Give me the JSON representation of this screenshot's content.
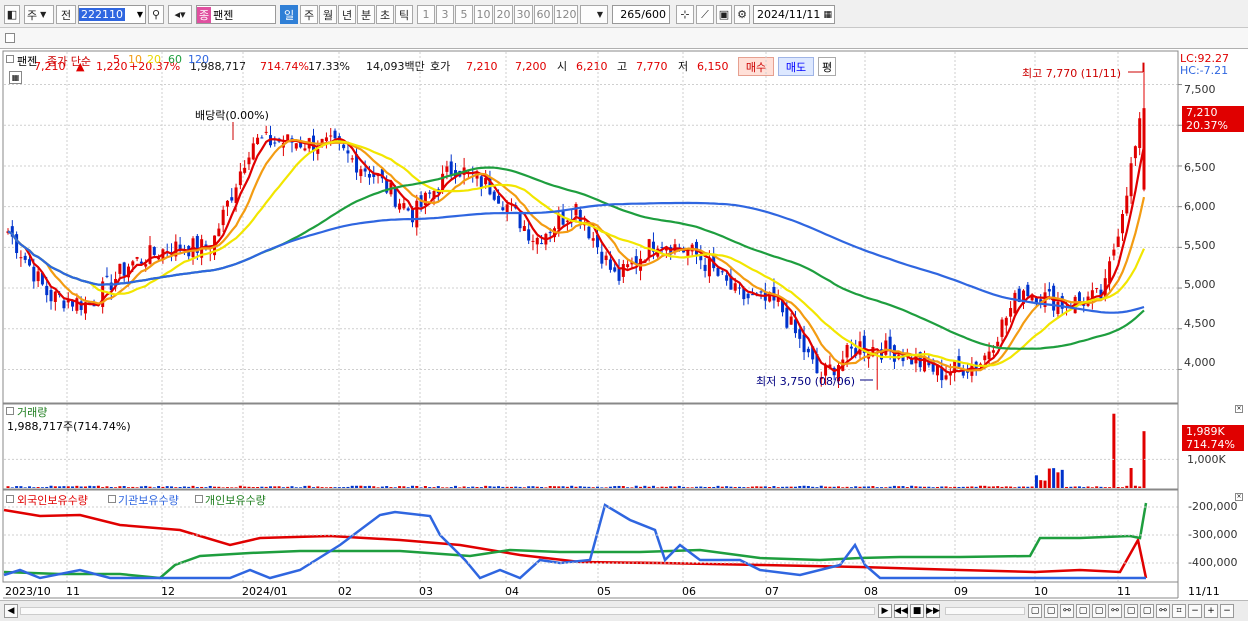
{
  "toolbar": {
    "market": "주",
    "scope": "전",
    "code": "222110",
    "name": "팬젠",
    "name_badge": "종",
    "periods": [
      "일",
      "주",
      "월",
      "년",
      "분",
      "초",
      "틱"
    ],
    "selected_period": "일",
    "intervals": [
      "1",
      "3",
      "5",
      "10",
      "20",
      "30",
      "60",
      "120"
    ],
    "count": "265",
    "count_max": "/600",
    "date": "2024/11/11"
  },
  "quote": {
    "price": "7,210",
    "change": "1,220",
    "change_pct": "+20.37%",
    "volume": "1,988,717",
    "volume_ratio": "714.74%",
    "turnover": "17.33%",
    "amount": "14,093백만",
    "bid_label": "호가",
    "ask": "7,210",
    "bid": "7,200",
    "open_label": "시",
    "open": "6,210",
    "high_label": "고",
    "high": "7,770",
    "low_label": "저",
    "low": "6,150",
    "buy": "매수",
    "sell": "매도",
    "avg": "평"
  },
  "price_panel": {
    "name_tag": "팬젠",
    "legend_label": "종가 단순",
    "ma": [
      {
        "period": "5",
        "color": "#e00000"
      },
      {
        "period": "10",
        "color": "#f39c12"
      },
      {
        "period": "20",
        "color": "#f2e600"
      },
      {
        "period": "60",
        "color": "#1e9e3e"
      },
      {
        "period": "120",
        "color": "#2f66e0"
      }
    ],
    "lc": "LC:92.27",
    "hc": "HC:-7.21",
    "last_price": "7,210",
    "last_pct": "20.37%",
    "high_annot": "최고 7,770 (11/11)",
    "low_annot": "최저 3,750 (08/06)",
    "div_annot": "배당락(0.00%)",
    "y_ticks": [
      "7,500",
      "7,000",
      "6,500",
      "6,000",
      "5,500",
      "5,000",
      "4,500",
      "4,000"
    ]
  },
  "volume_panel": {
    "title": "거래량",
    "value": "1,988,717주(714.74%)",
    "last": "1,989K",
    "last_pct": "714.74%",
    "tick": "1,000K"
  },
  "holding_panel": {
    "series": [
      {
        "name": "외국인보유수량",
        "color": "#e00000"
      },
      {
        "name": "기관보유수량",
        "color": "#2f66e0"
      },
      {
        "name": "개인보유수량",
        "color": "#1e9e3e"
      }
    ],
    "ticks": [
      "-200,000",
      "-300,000",
      "-400,000"
    ]
  },
  "x_axis": {
    "labels": [
      "2023/10",
      "11",
      "12",
      "2024/01",
      "02",
      "03",
      "04",
      "05",
      "06",
      "07",
      "08",
      "09",
      "10",
      "11"
    ],
    "last": "11/11"
  },
  "chart_data": {
    "type": "candlestick",
    "range": "2023/10 - 2024/11/11",
    "ylim": [
      3600,
      7900
    ],
    "y_ticks": [
      4000,
      4500,
      5000,
      5500,
      6000,
      6500,
      7000,
      7500
    ],
    "close_approx": [
      5700,
      4900,
      4800,
      5300,
      5500,
      5500,
      6800,
      6800,
      6750,
      6400,
      5900,
      6500,
      6200,
      5600,
      6000,
      5100,
      5600,
      5400,
      4900,
      4800,
      3900,
      4300,
      4200,
      3950,
      4100,
      5000,
      4800,
      4900,
      7210
    ],
    "high": {
      "value": 7770,
      "date": "11/11"
    },
    "low": {
      "value": 3750,
      "date": "08/06"
    },
    "last": 7210,
    "volume_last": 1988717
  }
}
